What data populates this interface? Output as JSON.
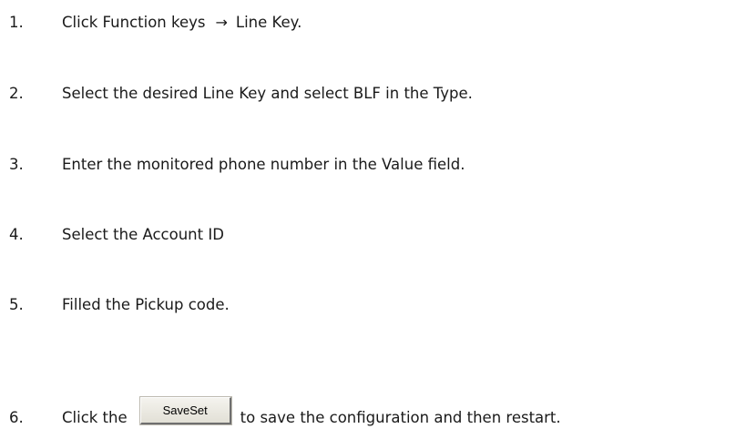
{
  "steps": [
    {
      "num": "1.",
      "before": "Click Function keys",
      "arrow": "→",
      "after": "Line Key."
    },
    {
      "num": "2.",
      "text": "Select the desired Line Key and select BLF in the Type."
    },
    {
      "num": "3.",
      "text": "Enter the monitored phone number in the Value field."
    },
    {
      "num": "4.",
      "text": "Select the Account ID"
    },
    {
      "num": "5.",
      "text": "Filled the Pickup code."
    },
    {
      "num": "6.",
      "before": "Click the",
      "button_label": "SaveSet",
      "after": "to save the configuration and then restart."
    }
  ]
}
